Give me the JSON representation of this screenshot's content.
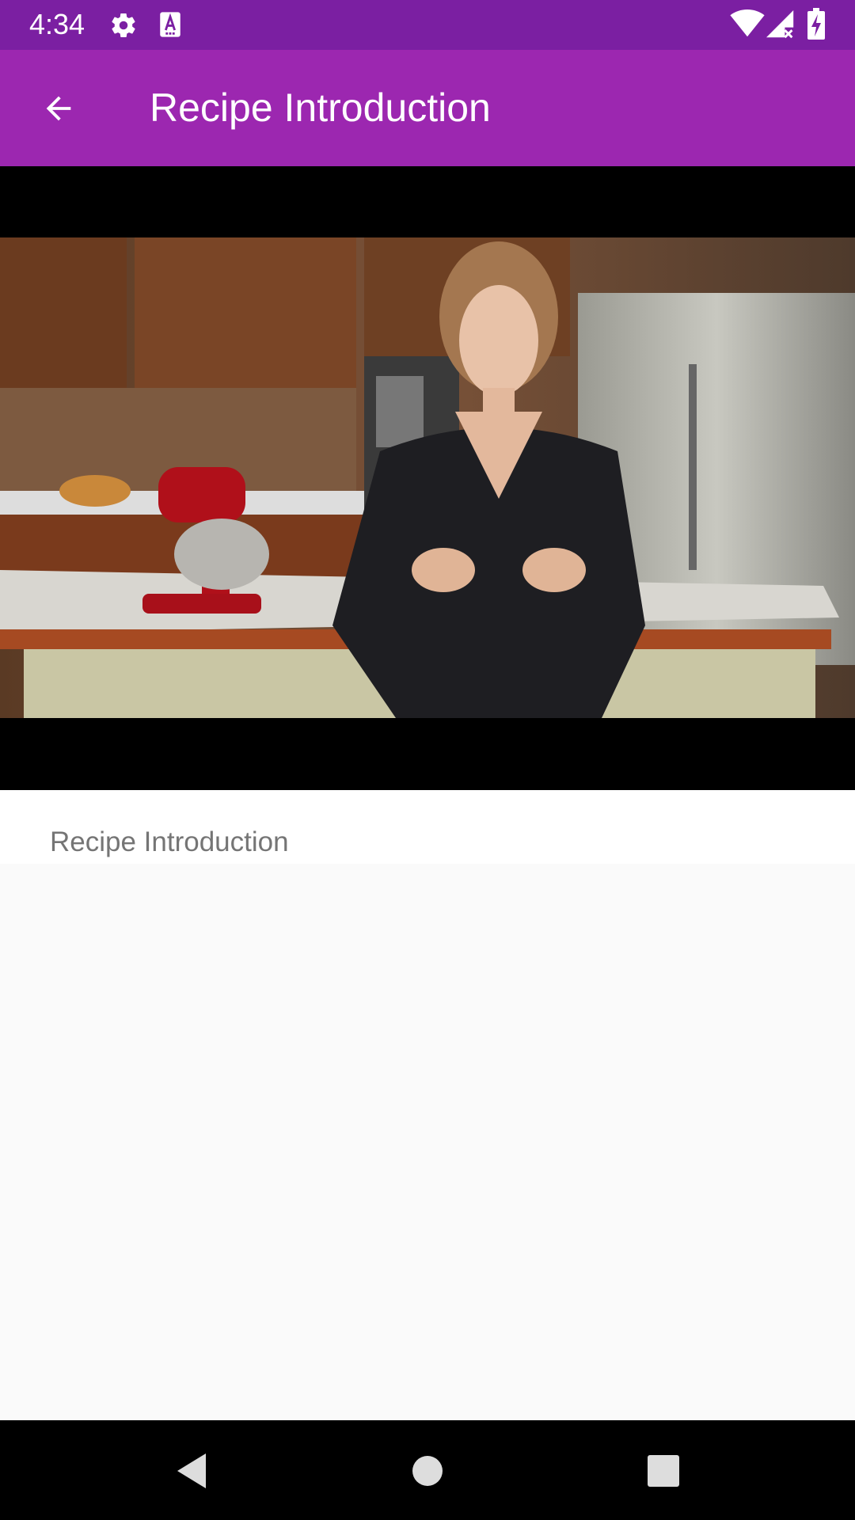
{
  "status_bar": {
    "time": "4:34",
    "icons": [
      "gear-icon",
      "text-a-icon",
      "wifi-icon",
      "signal-icon",
      "battery-charging-icon"
    ]
  },
  "app_bar": {
    "title": "Recipe Introduction",
    "back_icon": "arrow-back-icon",
    "color": "#9c27b0",
    "status_color": "#7b1fa2"
  },
  "video": {
    "scene": "presenter-in-kitchen"
  },
  "content": {
    "caption": "Recipe Introduction"
  },
  "nav_bar": {
    "buttons": [
      "back-triangle-icon",
      "home-circle-icon",
      "recents-square-icon"
    ]
  }
}
